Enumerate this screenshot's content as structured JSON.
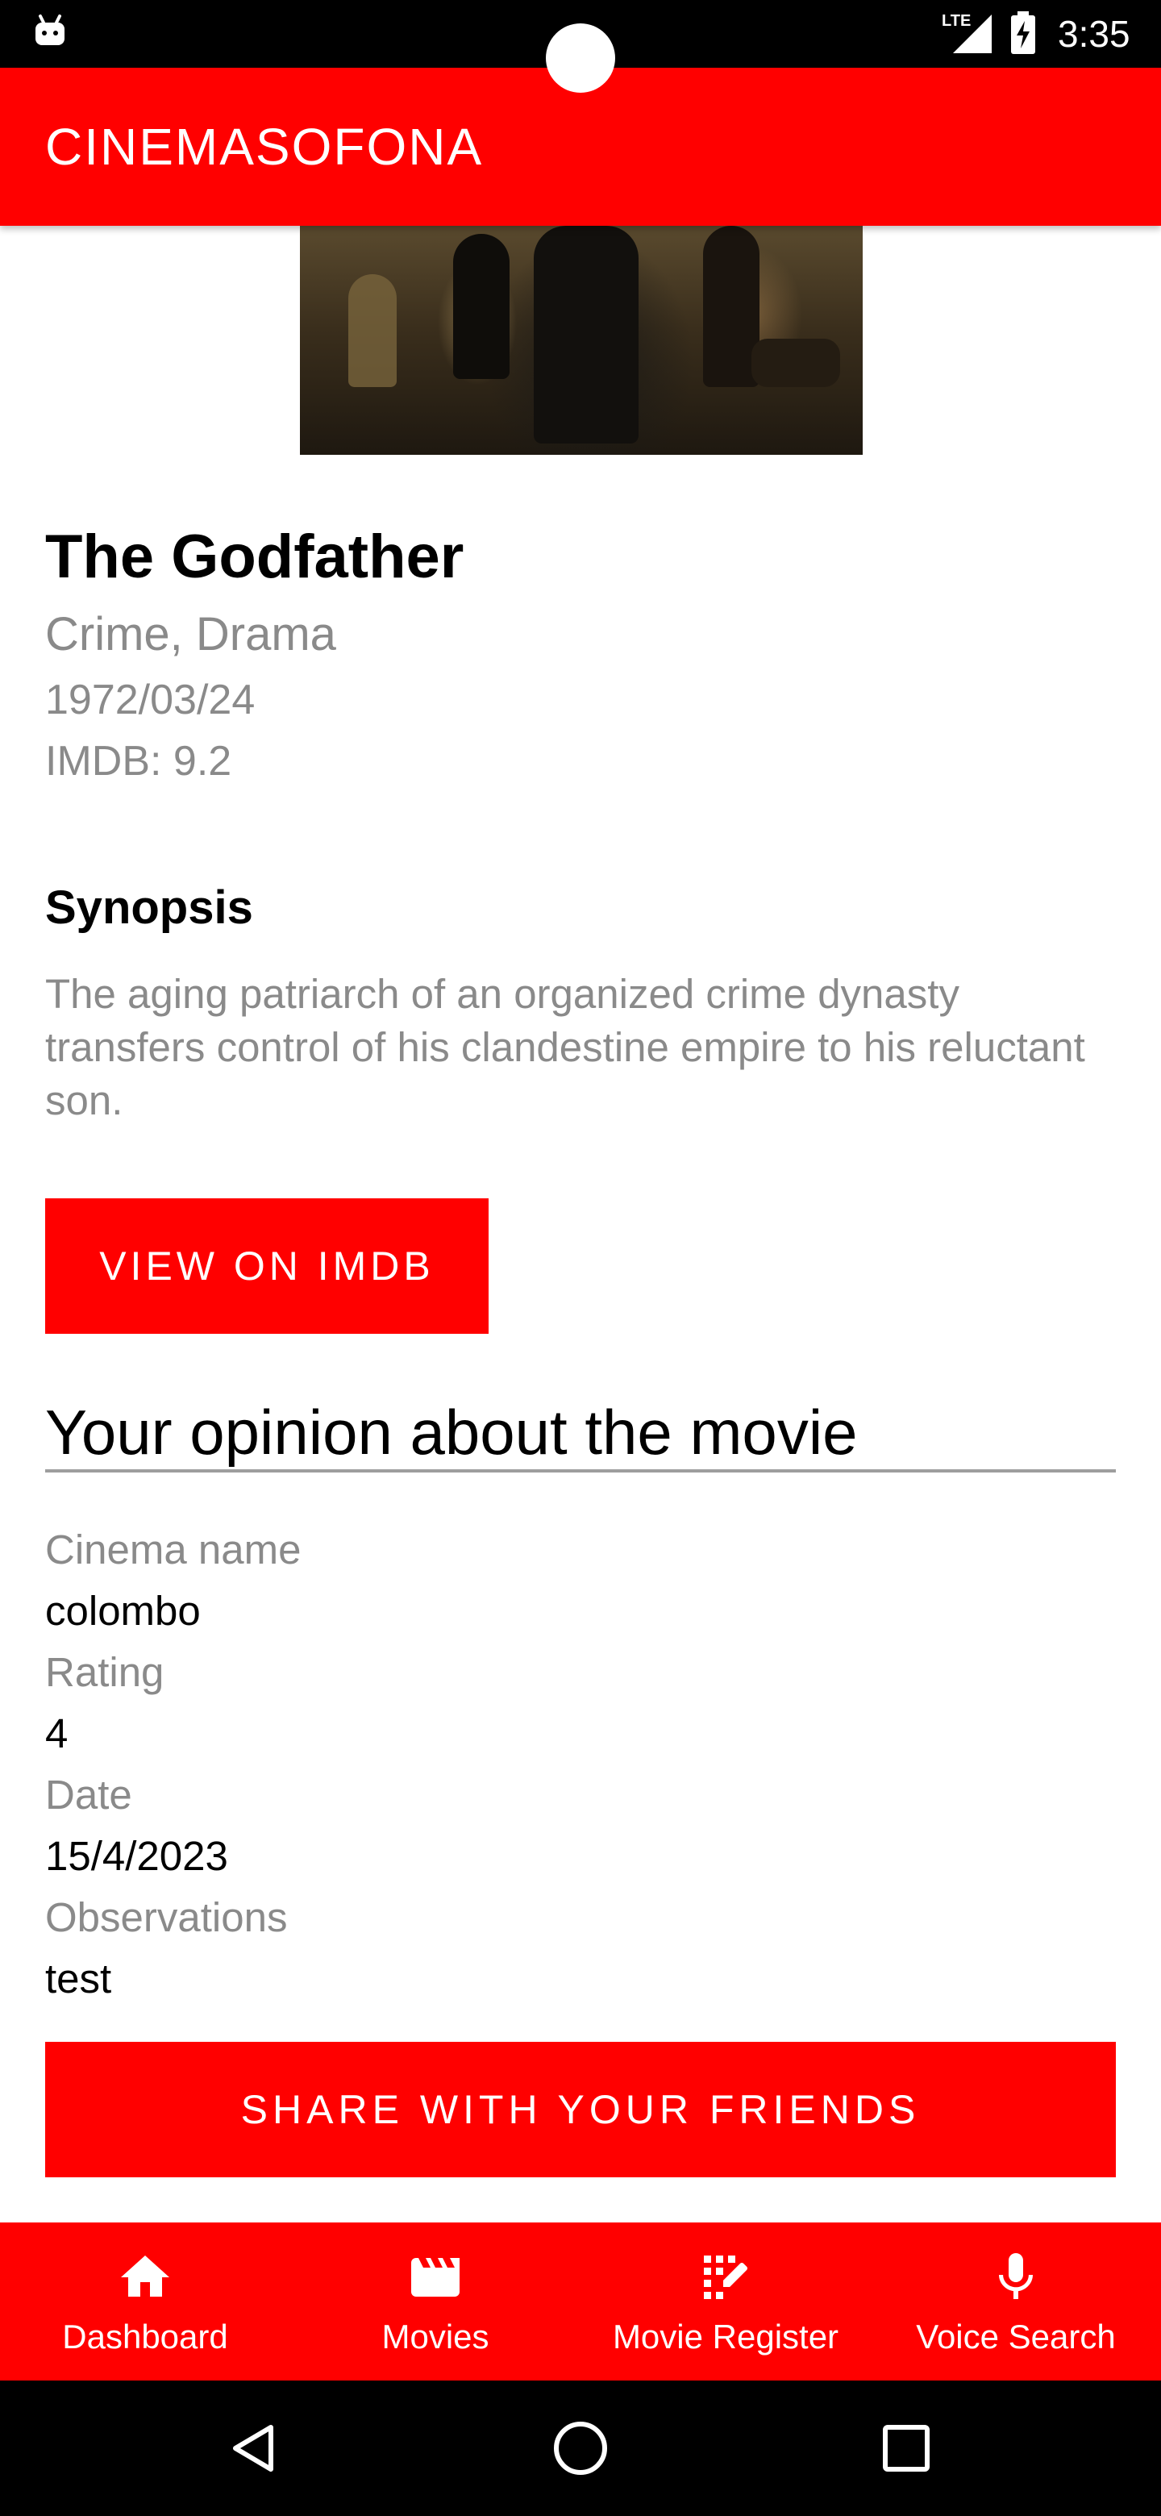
{
  "status_bar": {
    "time": "3:35",
    "network_label": "LTE",
    "icons": [
      "android-debug-icon",
      "lte-signal-icon",
      "battery-charging-icon"
    ]
  },
  "app_bar": {
    "title": "CINEMASOFONA"
  },
  "movie": {
    "poster_description_icon": "movie-poster-image",
    "title": "The Godfather",
    "genres": "Crime, Drama",
    "release_date": "1972/03/24",
    "imdb_rating": "IMDB: 9.2",
    "synopsis_heading": "Synopsis",
    "synopsis": "The aging patriarch of an organized crime dynasty transfers control of his clandestine empire to his reluctant son.",
    "imdb_button_label": "VIEW ON IMDB"
  },
  "opinion": {
    "heading": "Your opinion about the movie",
    "fields": [
      {
        "label": "Cinema name",
        "value": "colombo"
      },
      {
        "label": "Rating",
        "value": "4"
      },
      {
        "label": "Date",
        "value": "15/4/2023"
      },
      {
        "label": "Observations",
        "value": "test"
      }
    ],
    "share_button_label": "SHARE WITH YOUR FRIENDS"
  },
  "bottom_nav": {
    "items": [
      {
        "label": "Dashboard",
        "icon": "home-icon"
      },
      {
        "label": "Movies",
        "icon": "clapperboard-icon"
      },
      {
        "label": "Movie Register",
        "icon": "edit-grid-icon"
      },
      {
        "label": "Voice Search",
        "icon": "microphone-icon"
      }
    ]
  },
  "system_nav": {
    "icons": [
      "back-icon",
      "home-circle-icon",
      "recents-icon"
    ]
  },
  "colors": {
    "primary": "#ff0000",
    "on_primary": "#ffffff",
    "secondary_text": "#8a8a8a",
    "divider": "#9e9e9e"
  }
}
